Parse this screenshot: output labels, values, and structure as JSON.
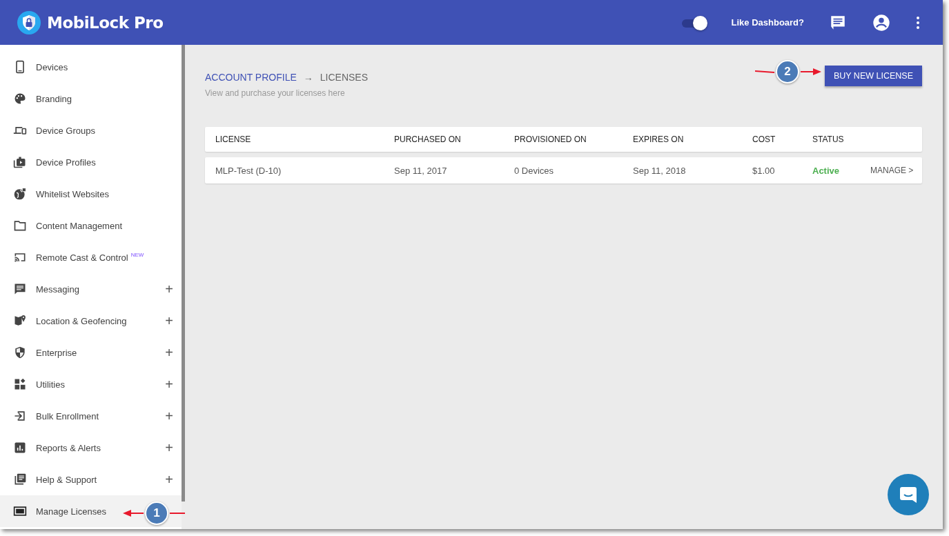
{
  "header": {
    "title": "MobiLock Pro",
    "toggle": {
      "on": true
    },
    "like_label": "Like Dashboard?"
  },
  "sidebar": {
    "items": [
      {
        "label": "Devices",
        "selected": false
      },
      {
        "label": "Branding",
        "selected": false
      },
      {
        "label": "Device Groups",
        "selected": false
      },
      {
        "label": "Device Profiles",
        "selected": false
      },
      {
        "label": "Whitelist Websites",
        "selected": false
      },
      {
        "label": "Content Management",
        "selected": false
      },
      {
        "label": "Remote Cast & Control",
        "badge": "NEW",
        "selected": false
      },
      {
        "label": "Messaging",
        "expand_sign": "+",
        "selected": false
      },
      {
        "label": "Location & Geofencing",
        "expand_sign": "+",
        "selected": false
      },
      {
        "label": "Enterprise",
        "expand_sign": "+",
        "selected": false
      },
      {
        "label": "Utilities",
        "expand_sign": "+",
        "selected": false
      },
      {
        "label": "Bulk Enrollment",
        "expand_sign": "+",
        "selected": false
      },
      {
        "label": "Reports & Alerts",
        "expand_sign": "+",
        "selected": false
      },
      {
        "label": "Help & Support",
        "expand_sign": "+",
        "selected": false
      },
      {
        "label": "Manage Licenses",
        "selected": true
      }
    ]
  },
  "breadcrumb": {
    "parent": "ACCOUNT PROFILE",
    "separator": "→",
    "current": "LICENSES",
    "subtitle": "View and purchase your licenses here"
  },
  "buy_button": "BUY NEW LICENSE",
  "table": {
    "columns": [
      "LICENSE",
      "PURCHASED ON",
      "PROVISIONED ON",
      "EXPIRES ON",
      "COST",
      "STATUS"
    ],
    "rows": [
      {
        "license": "MLP-Test (D-10)",
        "purchased_on": "Sep 11, 2017",
        "provisioned_on": "0 Devices",
        "expires_on": "Sep 11, 2018",
        "cost": "$1.00",
        "status": "Active",
        "color": "#4caf50",
        "action": "MANAGE",
        "action_sign": ">"
      }
    ]
  },
  "annotations": [
    {
      "number": "1"
    },
    {
      "number": "2"
    }
  ]
}
